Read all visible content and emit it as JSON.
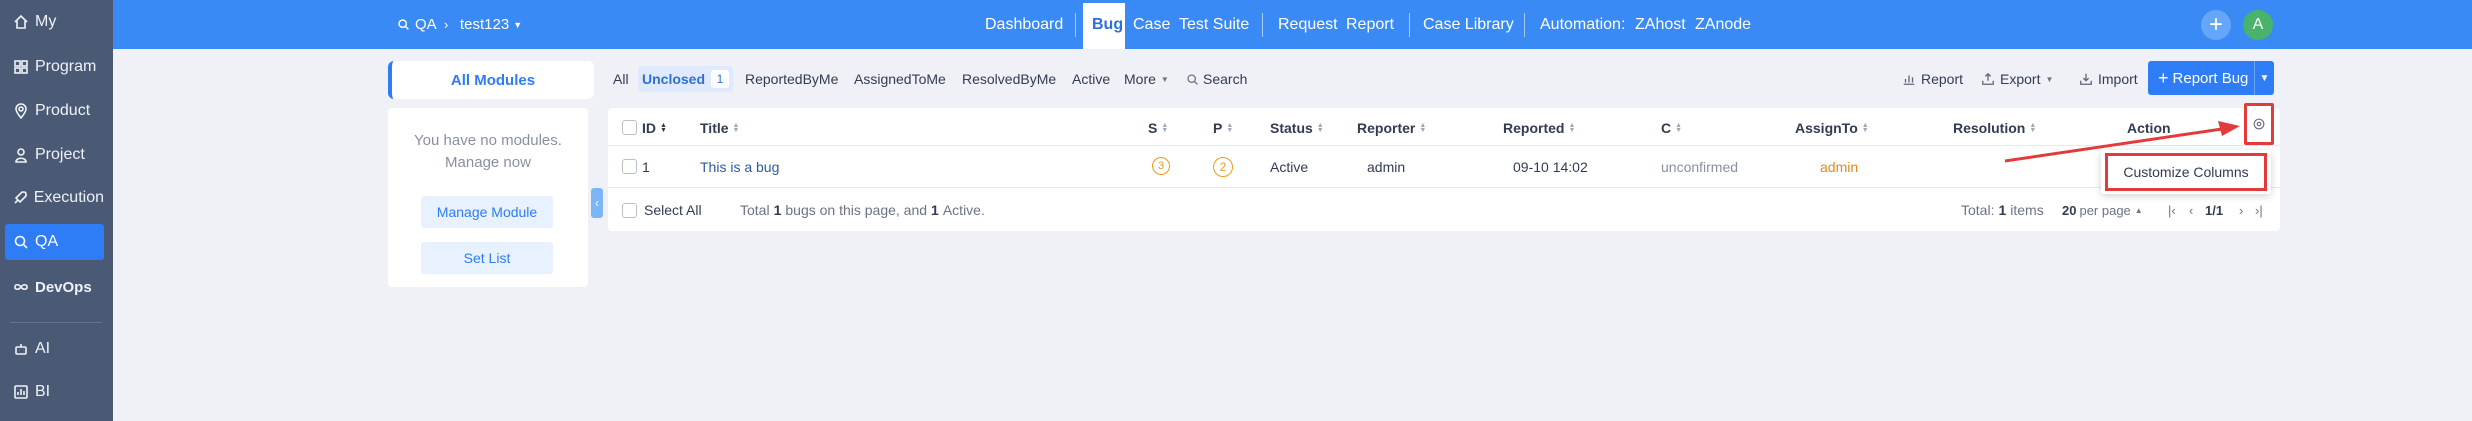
{
  "sidebar": {
    "items": [
      {
        "label": "My",
        "icon": "home-icon"
      },
      {
        "label": "Program",
        "icon": "grid-icon"
      },
      {
        "label": "Product",
        "icon": "pin-icon"
      },
      {
        "label": "Project",
        "icon": "user-icon"
      },
      {
        "label": "Execution",
        "icon": "rocket-icon"
      },
      {
        "label": "QA",
        "icon": "search-icon"
      },
      {
        "label": "DevOps",
        "icon": "infinity-icon"
      },
      {
        "label": "AI",
        "icon": "robot-icon"
      },
      {
        "label": "BI",
        "icon": "chart-icon"
      }
    ],
    "active": "QA"
  },
  "header": {
    "crumb_module": "QA",
    "crumb_product": "test123",
    "nav": [
      "Dashboard",
      "Bug",
      "Case",
      "Test Suite",
      "Request",
      "Report",
      "Case Library",
      "Automation:",
      "ZAhost",
      "ZAnode"
    ],
    "active_nav": "Bug",
    "avatar_letter": "A",
    "plus": "+"
  },
  "modules": {
    "tab_label": "All Modules",
    "empty_line1": "You have no modules.",
    "empty_line2": "Manage now",
    "manage_button": "Manage Module",
    "set_list_button": "Set List",
    "collapse_glyph": "‹"
  },
  "filters": {
    "all": "All",
    "unclosed": "Unclosed",
    "unclosed_count": "1",
    "reported_by_me": "ReportedByMe",
    "assigned_to_me": "AssignedToMe",
    "resolved_by_me": "ResolvedByMe",
    "active": "Active",
    "more": "More",
    "search": "Search"
  },
  "toolbar": {
    "report": "Report",
    "export": "Export",
    "import": "Import",
    "report_bug": "Report Bug"
  },
  "table": {
    "headers": [
      "ID",
      "Title",
      "S",
      "P",
      "Status",
      "Reporter",
      "Reported",
      "C",
      "AssignTo",
      "Resolution",
      "Action"
    ],
    "rows": [
      {
        "id": "1",
        "title": "This is a bug",
        "severity": "3",
        "priority": "2",
        "status": "Active",
        "reporter": "admin",
        "reported": "09-10 14:02",
        "confirmed": "unconfirmed",
        "assign_to": "admin"
      }
    ],
    "footer": {
      "select_all": "Select All",
      "summary_prefix": "Total",
      "summary_count": "1",
      "summary_mid": "bugs on this page, and",
      "summary_active": "1",
      "summary_suffix": "Active.",
      "total_label": "Total:",
      "total_count": "1",
      "total_unit": "items",
      "per_page_num": "20",
      "per_page_label": "per page",
      "page": "1/1"
    }
  },
  "dropdown": {
    "customize_columns": "Customize Columns"
  },
  "colors": {
    "header_bg": "#3a8af5",
    "sidebar_bg": "#4a5a75",
    "accent": "#2e7cf6",
    "highlight": "#e23b3b",
    "warning": "#f09a1c"
  }
}
